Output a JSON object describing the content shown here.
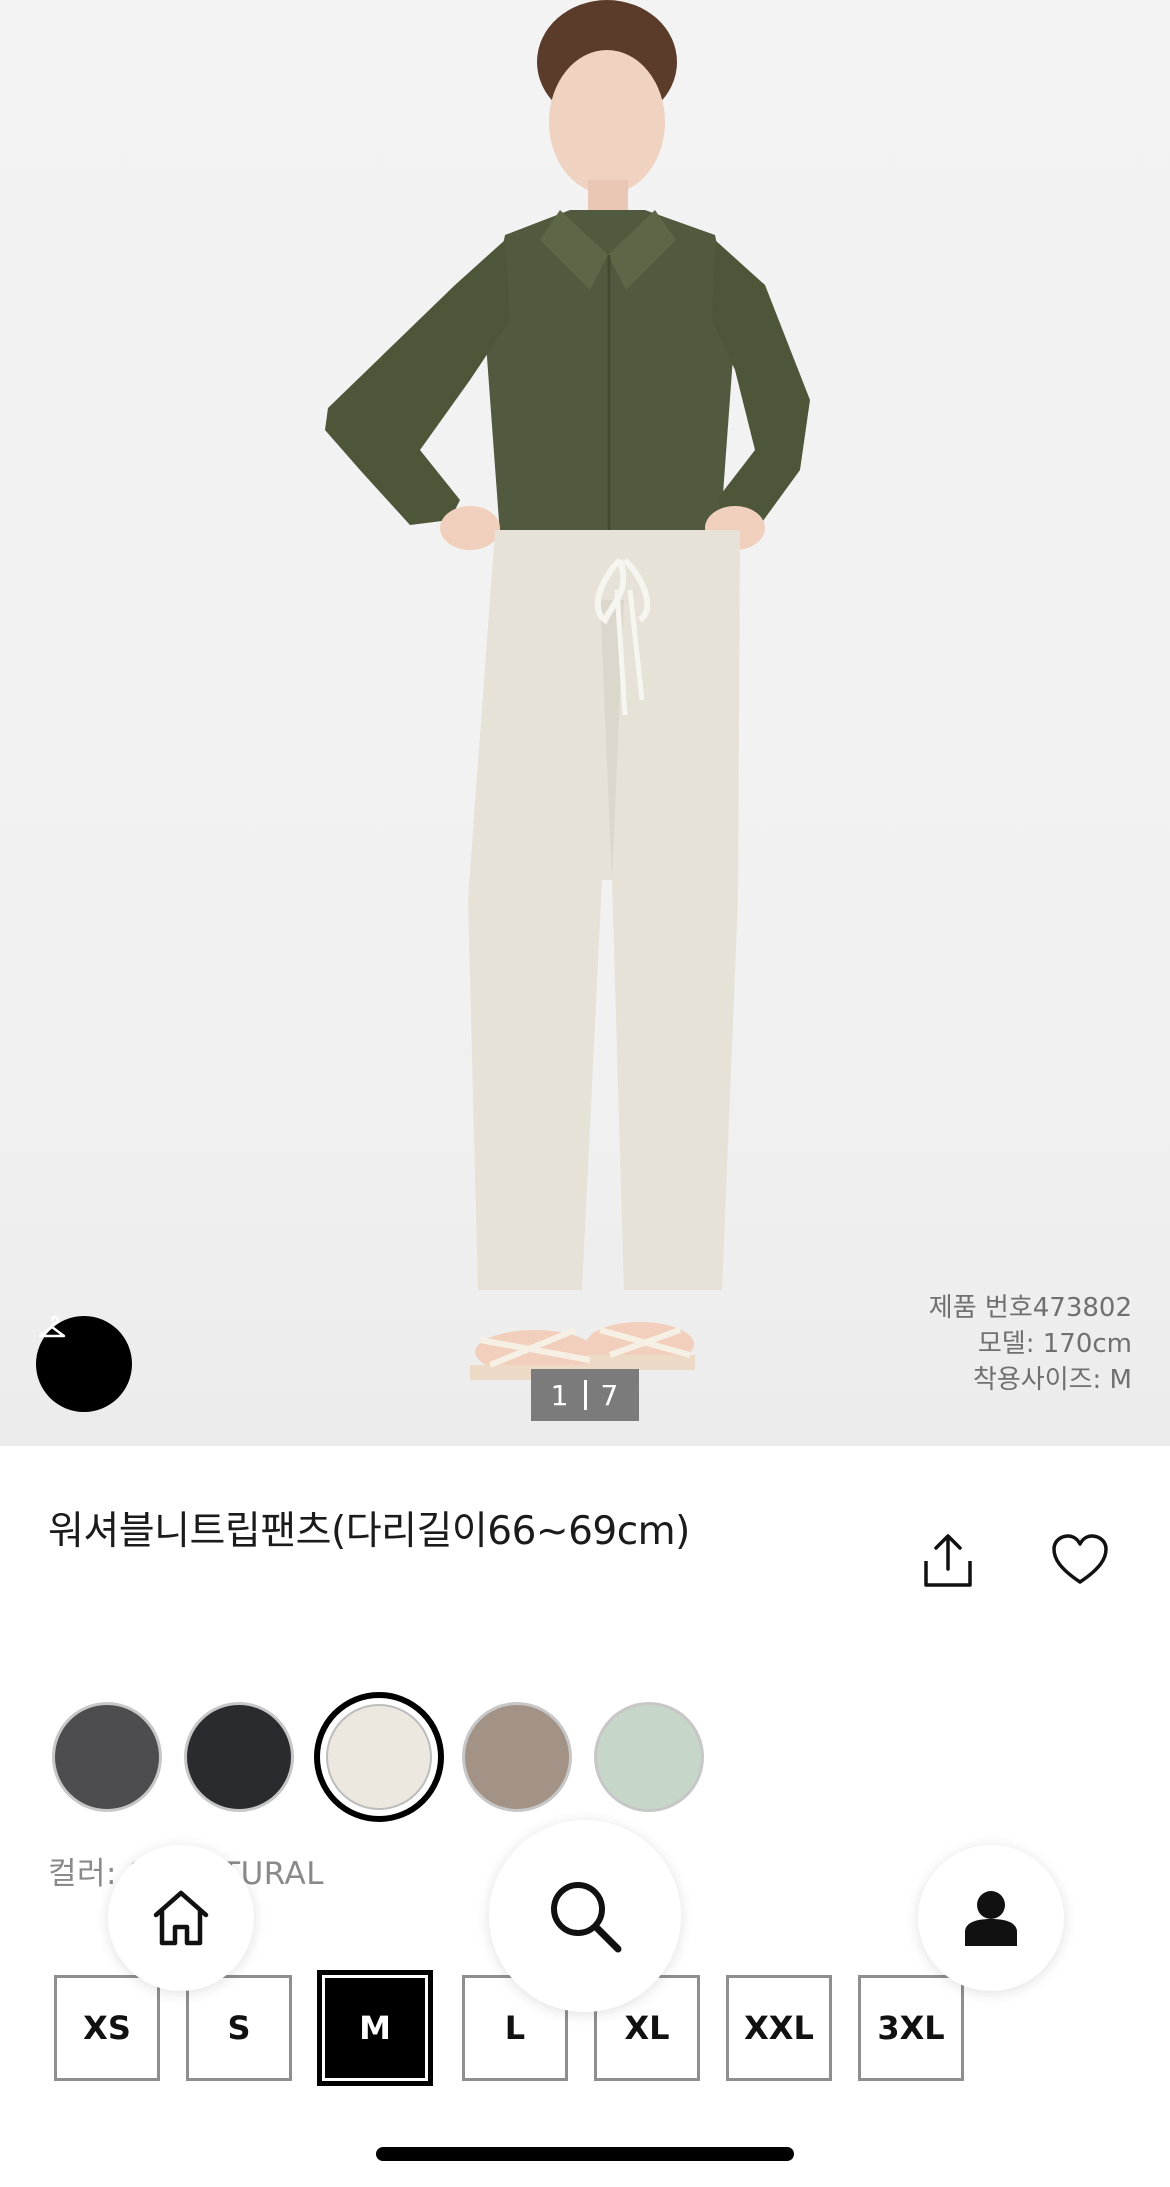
{
  "hero": {
    "counter_current": "1",
    "counter_total": "7",
    "product_number": "제품 번호473802",
    "model_height": "모델: 170cm",
    "model_size": "착용사이즈: M"
  },
  "product": {
    "title": "워셔블니트립팬츠(다리길이66~69cm)"
  },
  "swatches": [
    {
      "name": "dark gray",
      "color": "#4d4d4f",
      "selected": false
    },
    {
      "name": "black",
      "color": "#2a2b2e",
      "selected": false
    },
    {
      "name": "natural",
      "color": "#ece8df",
      "selected": true
    },
    {
      "name": "beige",
      "color": "#a39386",
      "selected": false
    },
    {
      "name": "mint",
      "color": "#c6d6c9",
      "selected": false
    }
  ],
  "color_label": "컬러: 01 NATURAL",
  "sizes": [
    {
      "label": "XS",
      "selected": false
    },
    {
      "label": "S",
      "selected": false
    },
    {
      "label": "M",
      "selected": true
    },
    {
      "label": "L",
      "selected": false
    },
    {
      "label": "XL",
      "selected": false
    },
    {
      "label": "XXL",
      "selected": false
    },
    {
      "label": "3XL",
      "selected": false
    }
  ],
  "nav": {
    "home_icon": "home-icon",
    "search_icon": "search-icon",
    "user_icon": "user-icon"
  },
  "colors": {
    "accent": "#000000",
    "counter_bg": "#7b7b7b"
  }
}
